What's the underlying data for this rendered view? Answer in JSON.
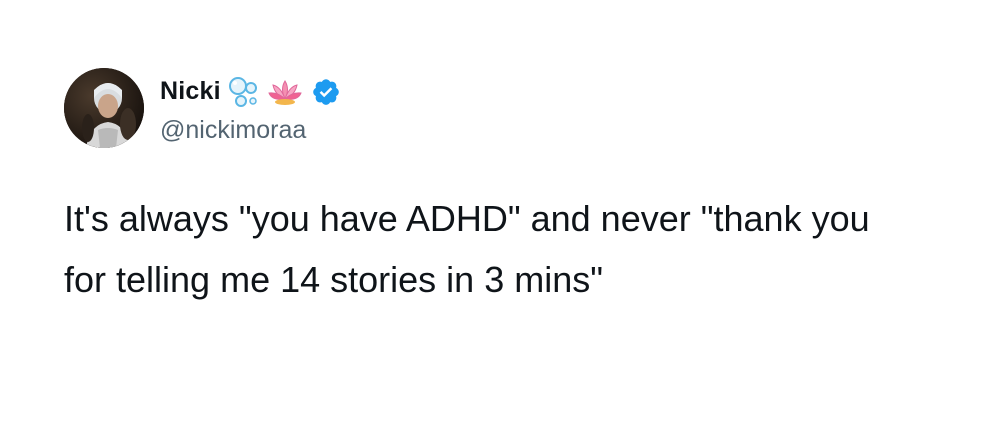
{
  "author": {
    "display_name": "Nicki",
    "handle": "@nickimoraa",
    "verified": true,
    "name_emojis": [
      "bubbles-icon",
      "lotus-icon"
    ],
    "avatar": "profile-photo"
  },
  "tweet": {
    "text": "It's always \"you have ADHD\" and never \"thank you for telling me 14 stories in 3 mins\""
  },
  "colors": {
    "text": "#0f1419",
    "secondary": "#536471",
    "verified": "#1d9bf0",
    "background": "#ffffff"
  }
}
